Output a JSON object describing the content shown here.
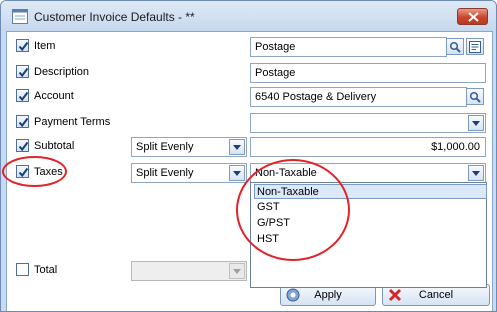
{
  "window": {
    "title": "Customer Invoice Defaults - **"
  },
  "rows": [
    {
      "label": "Item",
      "checked": true,
      "value": "Postage"
    },
    {
      "label": "Description",
      "checked": true,
      "value": "Postage"
    },
    {
      "label": "Account",
      "checked": true,
      "value": "6540  Postage & Delivery"
    },
    {
      "label": "Payment Terms",
      "checked": true,
      "value": ""
    },
    {
      "label": "Subtotal",
      "checked": true,
      "method": "Split Evenly",
      "value": "$1,000.00"
    },
    {
      "label": "Taxes",
      "checked": true,
      "method": "Split Evenly",
      "value": "Non-Taxable"
    },
    {
      "label": "Total",
      "checked": false,
      "method": "",
      "value": ""
    }
  ],
  "tax_options": [
    "Non-Taxable",
    "GST",
    "G/PST",
    "HST"
  ],
  "buttons": {
    "apply": "Apply",
    "cancel": "Cancel"
  },
  "colors": {
    "window_frame": "#c7dbf3",
    "close_button": "#c9462d",
    "highlight_circle": "#e2232a",
    "selected_item": "#dbe8f7"
  }
}
